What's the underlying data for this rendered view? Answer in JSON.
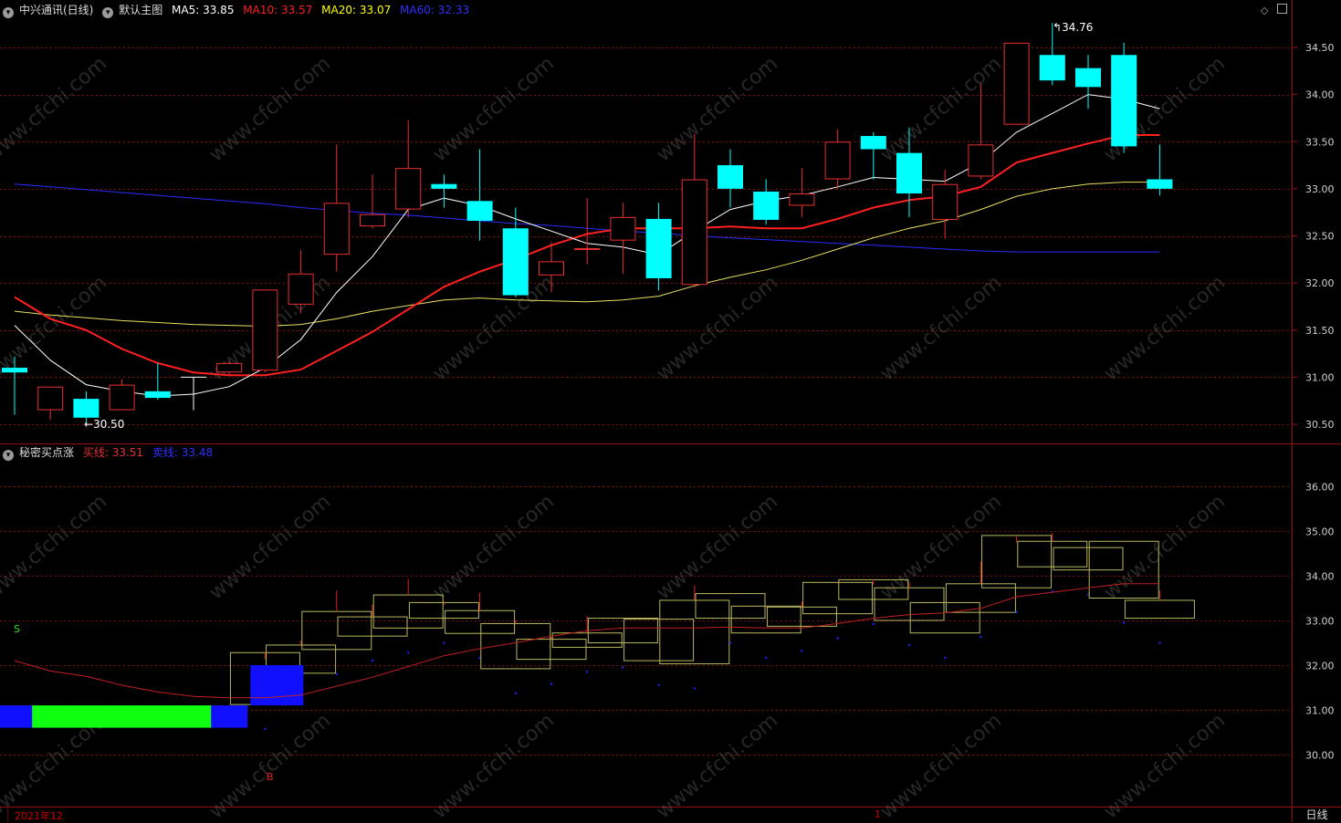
{
  "main_header": {
    "title": "中兴通讯(日线)",
    "template": "默认主图",
    "ma5": "MA5: 33.85",
    "ma10": "MA10: 33.57",
    "ma20": "MA20: 33.07",
    "ma60": "MA60: 32.33"
  },
  "sub_header": {
    "title": "秘密买点涨",
    "buy": "买线: 33.51",
    "sell": "卖线: 33.48"
  },
  "annotations": {
    "high": "34.76",
    "low": "30.50",
    "signal_s": "S",
    "signal_b": "B"
  },
  "footer": {
    "period_start": "2021年12",
    "period_mark": "1",
    "period_tab": "日线"
  },
  "watermark": "www.cfchi.com",
  "colors": {
    "ma5": "#ffffff",
    "ma10": "#ff2020",
    "ma20": "#ffff00",
    "ma60": "#2b2bff",
    "up": "#e83030",
    "down": "#00ffff",
    "grid": "#801010"
  },
  "chart_data": [
    {
      "type": "candlestick",
      "title": "中兴通讯(日线)",
      "y_ticks": [
        "34.50",
        "34.00",
        "33.50",
        "33.00",
        "32.50",
        "32.00",
        "31.50",
        "31.00",
        "30.50"
      ],
      "ylim": [
        30.3,
        34.95
      ],
      "candles": [
        {
          "o": 31.1,
          "c": 31.05,
          "h": 31.22,
          "l": 30.6,
          "dir": "down"
        },
        {
          "o": 30.65,
          "c": 30.9,
          "h": 30.9,
          "l": 30.55,
          "dir": "up"
        },
        {
          "o": 30.77,
          "c": 30.57,
          "h": 30.85,
          "l": 30.5,
          "dir": "down"
        },
        {
          "o": 30.65,
          "c": 30.92,
          "h": 30.98,
          "l": 30.65,
          "dir": "up"
        },
        {
          "o": 30.85,
          "c": 30.78,
          "h": 31.15,
          "l": 30.76,
          "dir": "down"
        },
        {
          "o": 31.0,
          "c": 31.0,
          "h": 31.0,
          "l": 30.65,
          "dir": "flat"
        },
        {
          "o": 31.05,
          "c": 31.15,
          "h": 31.17,
          "l": 31.03,
          "dir": "up"
        },
        {
          "o": 31.07,
          "c": 31.93,
          "h": 31.93,
          "l": 31.05,
          "dir": "up"
        },
        {
          "o": 31.77,
          "c": 32.1,
          "h": 32.35,
          "l": 31.68,
          "dir": "up"
        },
        {
          "o": 32.3,
          "c": 32.85,
          "h": 33.47,
          "l": 32.12,
          "dir": "up"
        },
        {
          "o": 32.6,
          "c": 32.73,
          "h": 33.15,
          "l": 32.58,
          "dir": "up"
        },
        {
          "o": 32.78,
          "c": 33.22,
          "h": 33.73,
          "l": 32.7,
          "dir": "up"
        },
        {
          "o": 33.05,
          "c": 33.0,
          "h": 33.15,
          "l": 32.8,
          "dir": "down"
        },
        {
          "o": 32.87,
          "c": 32.66,
          "h": 33.42,
          "l": 32.45,
          "dir": "down"
        },
        {
          "o": 32.58,
          "c": 31.87,
          "h": 32.8,
          "l": 31.85,
          "dir": "down"
        },
        {
          "o": 32.08,
          "c": 32.23,
          "h": 32.43,
          "l": 31.9,
          "dir": "up"
        },
        {
          "o": 32.35,
          "c": 32.37,
          "h": 32.9,
          "l": 32.2,
          "dir": "up"
        },
        {
          "o": 32.45,
          "c": 32.7,
          "h": 32.85,
          "l": 32.1,
          "dir": "up"
        },
        {
          "o": 32.68,
          "c": 32.05,
          "h": 32.85,
          "l": 31.92,
          "dir": "down"
        },
        {
          "o": 31.98,
          "c": 33.1,
          "h": 33.58,
          "l": 31.95,
          "dir": "up"
        },
        {
          "o": 33.25,
          "c": 33.0,
          "h": 33.42,
          "l": 32.8,
          "dir": "down"
        },
        {
          "o": 32.97,
          "c": 32.67,
          "h": 33.1,
          "l": 32.62,
          "dir": "down"
        },
        {
          "o": 32.82,
          "c": 32.95,
          "h": 33.22,
          "l": 32.7,
          "dir": "up"
        },
        {
          "o": 33.1,
          "c": 33.5,
          "h": 33.63,
          "l": 33.0,
          "dir": "up"
        },
        {
          "o": 33.56,
          "c": 33.42,
          "h": 33.6,
          "l": 33.1,
          "dir": "down"
        },
        {
          "o": 33.38,
          "c": 32.95,
          "h": 33.65,
          "l": 32.7,
          "dir": "down"
        },
        {
          "o": 32.67,
          "c": 33.05,
          "h": 33.2,
          "l": 32.47,
          "dir": "up"
        },
        {
          "o": 33.13,
          "c": 33.47,
          "h": 34.12,
          "l": 33.1,
          "dir": "up"
        },
        {
          "o": 33.68,
          "c": 34.55,
          "h": 34.55,
          "l": 33.68,
          "dir": "up"
        },
        {
          "o": 34.42,
          "c": 34.15,
          "h": 34.76,
          "l": 34.1,
          "dir": "down"
        },
        {
          "o": 34.28,
          "c": 34.08,
          "h": 34.42,
          "l": 33.85,
          "dir": "down"
        },
        {
          "o": 34.42,
          "c": 33.45,
          "h": 34.55,
          "l": 33.38,
          "dir": "down"
        },
        {
          "o": 33.1,
          "c": 33.0,
          "h": 33.47,
          "l": 32.93,
          "dir": "down"
        }
      ],
      "ma5": [
        31.55,
        31.18,
        30.92,
        30.85,
        30.8,
        30.82,
        30.9,
        31.1,
        31.4,
        31.9,
        32.28,
        32.78,
        32.9,
        32.82,
        32.68,
        32.55,
        32.42,
        32.38,
        32.3,
        32.55,
        32.78,
        32.87,
        32.93,
        33.02,
        33.12,
        33.1,
        33.08,
        33.28,
        33.6,
        33.8,
        34.0,
        33.95,
        33.85
      ],
      "ma10": [
        31.85,
        31.62,
        31.5,
        31.3,
        31.15,
        31.05,
        31.02,
        31.02,
        31.08,
        31.28,
        31.48,
        31.72,
        31.96,
        32.12,
        32.25,
        32.4,
        32.52,
        32.58,
        32.58,
        32.58,
        32.6,
        32.58,
        32.58,
        32.68,
        32.8,
        32.88,
        32.92,
        33.02,
        33.28,
        33.38,
        33.48,
        33.57,
        33.57
      ],
      "ma20": [
        31.7,
        31.66,
        31.63,
        31.6,
        31.58,
        31.56,
        31.55,
        31.54,
        31.56,
        31.62,
        31.7,
        31.76,
        31.82,
        31.84,
        31.82,
        31.81,
        31.8,
        31.82,
        31.86,
        31.97,
        32.06,
        32.14,
        32.24,
        32.36,
        32.48,
        32.58,
        32.66,
        32.78,
        32.92,
        33.0,
        33.05,
        33.07,
        33.07
      ],
      "ma60": [
        33.05,
        33.02,
        32.99,
        32.96,
        32.93,
        32.9,
        32.87,
        32.84,
        32.8,
        32.77,
        32.74,
        32.72,
        32.69,
        32.66,
        32.63,
        32.61,
        32.58,
        32.55,
        32.53,
        32.5,
        32.48,
        32.46,
        32.44,
        32.42,
        32.4,
        32.38,
        32.36,
        32.34,
        32.33,
        32.33,
        32.33,
        32.33,
        32.33
      ]
    },
    {
      "type": "box-indicator",
      "title": "秘密买点涨",
      "y_ticks": [
        "36.00",
        "35.00",
        "34.00",
        "33.00",
        "32.00",
        "31.00",
        "30.00"
      ],
      "ylim": [
        29.15,
        36.6
      ],
      "buy_line": 33.51,
      "sell_line": 33.48
    }
  ]
}
